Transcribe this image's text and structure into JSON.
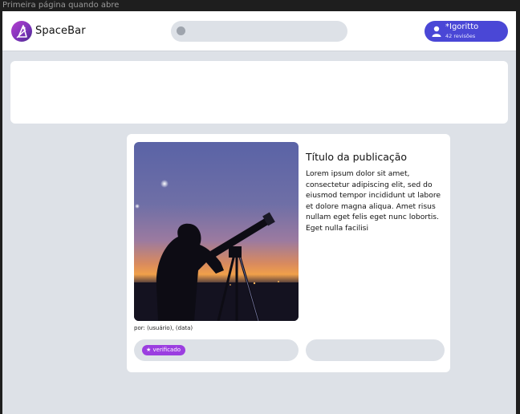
{
  "frame": {
    "label": "Primeira página quando abre"
  },
  "header": {
    "brand": "SpaceBar",
    "search": {
      "value": "",
      "placeholder": ""
    },
    "user": {
      "name": "*Igoritto",
      "reviews": "42 revisões"
    }
  },
  "post": {
    "title": "Título da publicação",
    "body": "Lorem ipsum dolor sit amet, consectetur adipiscing elit, sed do eiusmod tempor incididunt ut labore et dolore magna aliqua. Amet risus nullam eget felis eget nunc lobortis. Eget nulla facilisi",
    "author_line": "por: (usuário), (data)",
    "badge": "★ verificado",
    "image": "stargazer-with-telescope-photo"
  },
  "colors": {
    "accent": "#4a47d6",
    "badge": "#9b3ee0",
    "background": "#dde1e7",
    "card": "#ffffff"
  },
  "icons": {
    "logo": "rocket-logo-icon",
    "search": "search-icon",
    "user": "user-icon"
  }
}
